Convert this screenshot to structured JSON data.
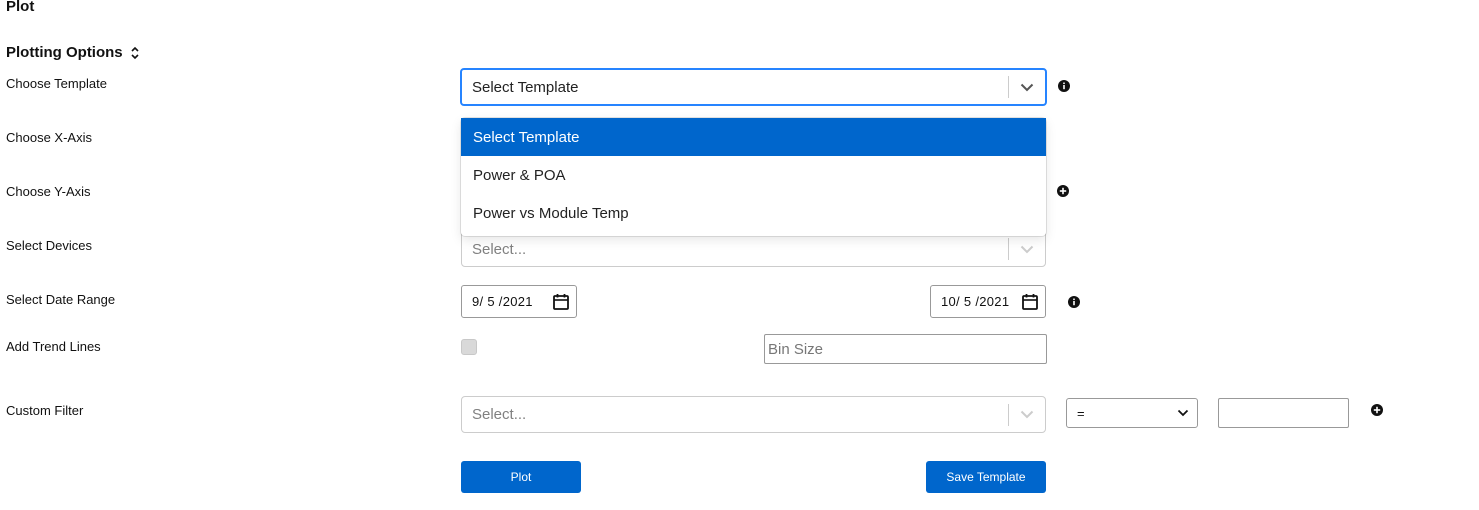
{
  "page": {
    "title": "Plot"
  },
  "plotting_options": {
    "title": "Plotting Options",
    "collapse_icon": "collapse-arrows-icon"
  },
  "labels": {
    "choose_template": "Choose Template",
    "choose_x_axis": "Choose X-Axis",
    "choose_y_axis": "Choose Y-Axis",
    "select_devices": "Select Devices",
    "select_date_range": "Select Date Range",
    "add_trend_lines": "Add Trend Lines",
    "custom_filter": "Custom Filter"
  },
  "template_select": {
    "value": "Select Template",
    "options": [
      "Select Template",
      "Power & POA",
      "Power vs Module Temp"
    ],
    "selected_index": 0
  },
  "devices_select": {
    "placeholder": "Select..."
  },
  "date_range": {
    "start": "9/ 5 /2021",
    "end": "10/ 5 /2021"
  },
  "trend_lines": {
    "checked": false
  },
  "bin_size": {
    "placeholder": "Bin Size",
    "value": ""
  },
  "custom_filter": {
    "field_placeholder": "Select...",
    "operator": "=",
    "value": ""
  },
  "buttons": {
    "plot": "Plot",
    "save_template": "Save Template"
  },
  "colors": {
    "primary": "#0066cc",
    "focus": "#2684ff",
    "border": "#cccccc"
  }
}
